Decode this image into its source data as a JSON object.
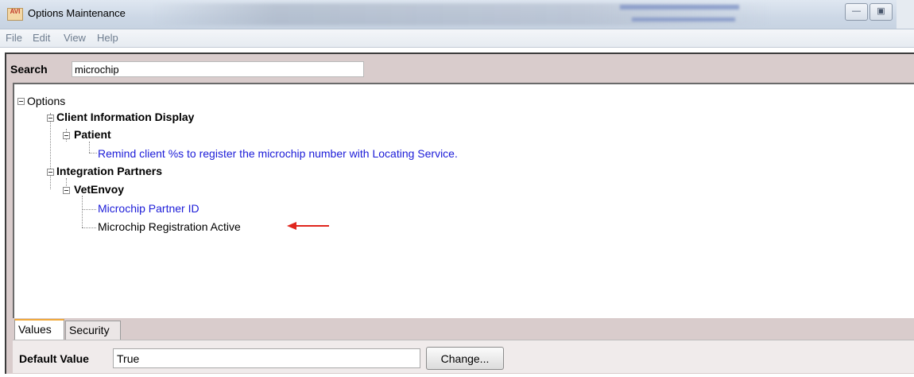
{
  "window": {
    "title": "Options Maintenance",
    "icon_text": "AVI"
  },
  "menu": [
    "File",
    "Edit",
    "View",
    "Help"
  ],
  "search": {
    "label": "Search",
    "value": "microchip"
  },
  "tree": {
    "root": "Options",
    "nodes": [
      {
        "label": "Client Information Display"
      },
      {
        "label": "Patient"
      },
      {
        "label": "Remind client %s to register the microchip number with Locating Service."
      },
      {
        "label": "Integration Partners"
      },
      {
        "label": "VetEnvoy"
      },
      {
        "label": "Microchip Partner ID"
      },
      {
        "label": "Microchip Registration Active"
      }
    ]
  },
  "tabs": [
    "Values",
    "Security"
  ],
  "default_value": {
    "label": "Default Value",
    "value": "True"
  },
  "change_button": "Change...",
  "colors": {
    "link_blue": "#1c1cd8",
    "annotation_arrow": "#e0261d",
    "frame_background": "#d9cccc"
  }
}
